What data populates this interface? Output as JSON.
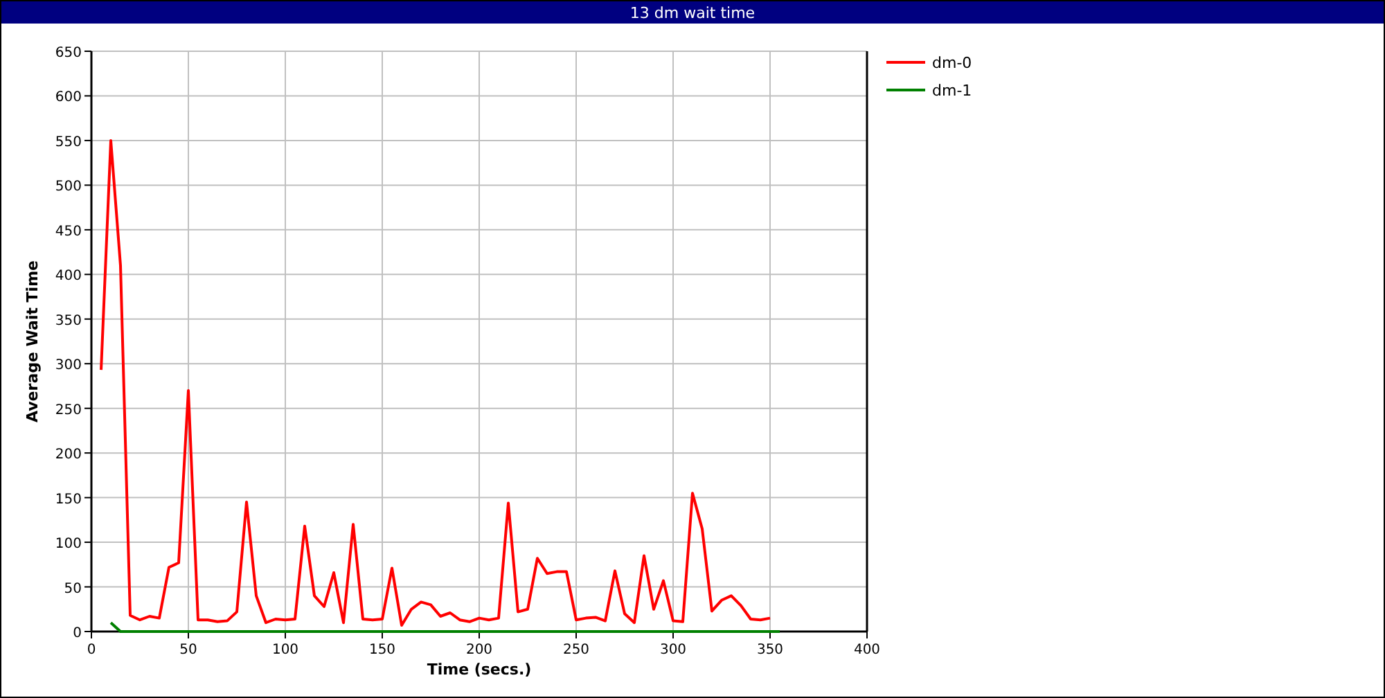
{
  "window": {
    "title": "13 dm wait time"
  },
  "chart": {
    "chart_data": {
      "type": "line",
      "xlabel": "Time (secs.)",
      "ylabel": "Average Wait Time",
      "x": [
        5,
        10,
        15,
        20,
        25,
        30,
        35,
        40,
        45,
        50,
        55,
        60,
        65,
        70,
        75,
        80,
        85,
        90,
        95,
        100,
        105,
        110,
        115,
        120,
        125,
        130,
        135,
        140,
        145,
        150,
        155,
        160,
        165,
        170,
        175,
        180,
        185,
        190,
        195,
        200,
        205,
        210,
        215,
        220,
        225,
        230,
        235,
        240,
        245,
        250,
        255,
        260,
        265,
        270,
        275,
        280,
        285,
        290,
        295,
        300,
        305,
        310,
        315,
        320,
        325,
        330,
        335,
        340,
        345,
        350,
        355
      ],
      "series": [
        {
          "name": "dm-0",
          "color": "#ff0000",
          "values": [
            293,
            550,
            410,
            18,
            13,
            17,
            15,
            72,
            77,
            270,
            13,
            13,
            11,
            12,
            22,
            145,
            40,
            10,
            14,
            13,
            14,
            118,
            40,
            28,
            66,
            10,
            120,
            14,
            13,
            14,
            71,
            7,
            25,
            33,
            30,
            17,
            21,
            13,
            11,
            15,
            13,
            15,
            144,
            22,
            25,
            82,
            65,
            67,
            67,
            13,
            15,
            16,
            12,
            68,
            20,
            10,
            85,
            25,
            57,
            12,
            11,
            155,
            115,
            23,
            35,
            40,
            29,
            14,
            13,
            15,
            null
          ]
        },
        {
          "name": "dm-1",
          "color": "#008000",
          "values": [
            null,
            10,
            0,
            0,
            0,
            0,
            0,
            0,
            0,
            0,
            0,
            0,
            0,
            0,
            0,
            0,
            0,
            0,
            0,
            0,
            0,
            0,
            0,
            0,
            0,
            0,
            0,
            0,
            0,
            0,
            0,
            0,
            0,
            0,
            0,
            0,
            0,
            0,
            0,
            0,
            0,
            0,
            0,
            0,
            0,
            0,
            0,
            0,
            0,
            0,
            0,
            0,
            0,
            0,
            0,
            0,
            0,
            0,
            0,
            0,
            0,
            0,
            0,
            0,
            0,
            0,
            0,
            0,
            0,
            0,
            0
          ]
        }
      ],
      "xlim": [
        0,
        400
      ],
      "ylim": [
        0,
        650
      ],
      "xticks": [
        0,
        50,
        100,
        150,
        200,
        250,
        300,
        350,
        400
      ],
      "yticks": [
        0,
        50,
        100,
        150,
        200,
        250,
        300,
        350,
        400,
        450,
        500,
        550,
        600,
        650
      ],
      "grid": true,
      "legend": true
    }
  }
}
